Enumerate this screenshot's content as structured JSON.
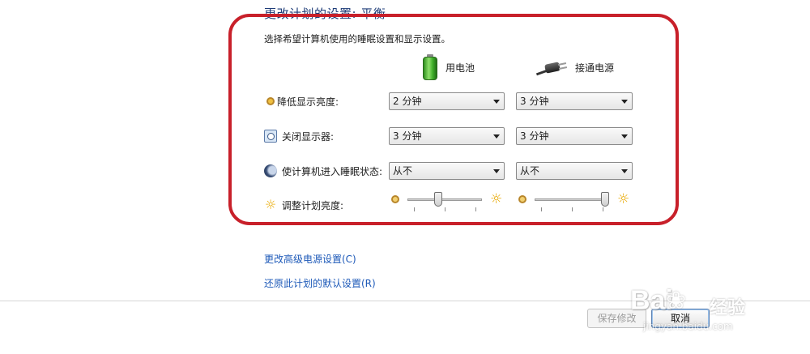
{
  "header": {
    "title": "更改计划的设置: 平衡",
    "instructions": "选择希望计算机使用的睡眠设置和显示设置。"
  },
  "columns": {
    "battery": {
      "label": "用电池",
      "icon": "battery-icon"
    },
    "plugged_in": {
      "label": "接通电源",
      "icon": "power-plug-icon"
    }
  },
  "settings": [
    {
      "label": "降低显示亮度:",
      "icon": "dim-display-icon",
      "battery": "2 分钟",
      "plugged_in": "3 分钟"
    },
    {
      "label": "关闭显示器:",
      "icon": "monitor-off-icon",
      "battery": "3 分钟",
      "plugged_in": "3 分钟"
    },
    {
      "label": "使计算机进入睡眠状态:",
      "icon": "sleep-moon-icon",
      "battery": "从不",
      "plugged_in": "从不"
    }
  ],
  "brightness": {
    "label": "调整计划亮度:",
    "icon": "brightness-sun-icon",
    "battery_level": 0.4,
    "plugged_in_level": 1.0
  },
  "links": {
    "advanced": "更改高级电源设置(C)",
    "restore": "还原此计划的默认设置(R)"
  },
  "buttons": {
    "save": "保存修改",
    "cancel": "取消"
  },
  "watermark": {
    "brand": "Bai",
    "brand_cn": "经验",
    "url": "jingyan.baidu.com"
  },
  "annotation_color": "#c8202a",
  "link_color": "#1d59b8"
}
